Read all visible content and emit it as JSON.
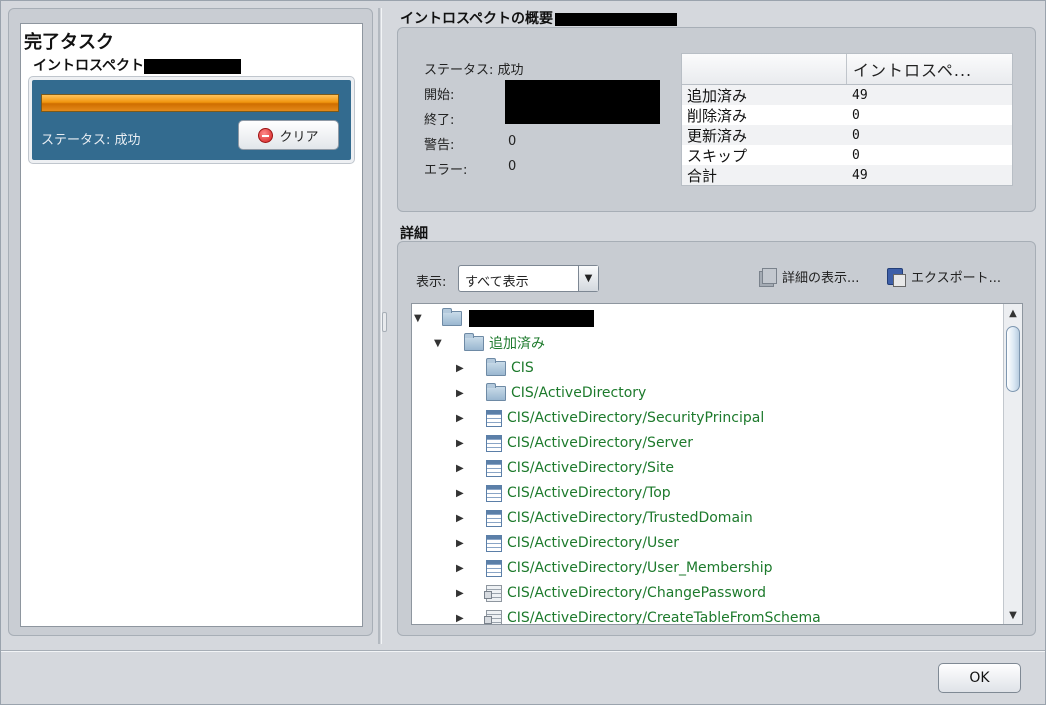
{
  "left": {
    "title": "完了タスク",
    "task_name": "イントロスペクト",
    "progress_percent": 100,
    "status": "ステータス: 成功",
    "clear_label": "クリア"
  },
  "summary": {
    "heading": "イントロスペクトの概要",
    "status": "ステータス: 成功",
    "start_label": "開始:",
    "end_label": "終了:",
    "warning_label": "警告:",
    "warning_value": "0",
    "error_label": "エラー:",
    "error_value": "0",
    "table_header": "イントロスペ...",
    "rows": [
      {
        "label": "追加済み",
        "value": "49"
      },
      {
        "label": "削除済み",
        "value": "0"
      },
      {
        "label": "更新済み",
        "value": "0"
      },
      {
        "label": "スキップ",
        "value": "0"
      },
      {
        "label": "合計",
        "value": "49"
      }
    ]
  },
  "details": {
    "heading": "詳細",
    "show_label": "表示:",
    "show_selected": "すべて表示",
    "show_details_label": "詳細の表示...",
    "export_label": "エクスポート...",
    "tree": [
      {
        "level": 1,
        "label": "追加済み",
        "icon": "folder-icon"
      },
      {
        "level": 2,
        "label": "CIS",
        "icon": "folder-icon"
      },
      {
        "level": 2,
        "label": "CIS/ActiveDirectory",
        "icon": "folder-icon"
      },
      {
        "level": 2,
        "label": "CIS/ActiveDirectory/SecurityPrincipal",
        "icon": "table-icon"
      },
      {
        "level": 2,
        "label": "CIS/ActiveDirectory/Server",
        "icon": "table-icon"
      },
      {
        "level": 2,
        "label": "CIS/ActiveDirectory/Site",
        "icon": "table-icon"
      },
      {
        "level": 2,
        "label": "CIS/ActiveDirectory/Top",
        "icon": "table-icon"
      },
      {
        "level": 2,
        "label": "CIS/ActiveDirectory/TrustedDomain",
        "icon": "table-icon"
      },
      {
        "level": 2,
        "label": "CIS/ActiveDirectory/User",
        "icon": "table-icon"
      },
      {
        "level": 2,
        "label": "CIS/ActiveDirectory/User_Membership",
        "icon": "table-icon"
      },
      {
        "level": 2,
        "label": "CIS/ActiveDirectory/ChangePassword",
        "icon": "script-icon"
      },
      {
        "level": 2,
        "label": "CIS/ActiveDirectory/CreateTableFromSchema",
        "icon": "script-icon"
      }
    ]
  },
  "footer": {
    "ok_label": "OK"
  }
}
